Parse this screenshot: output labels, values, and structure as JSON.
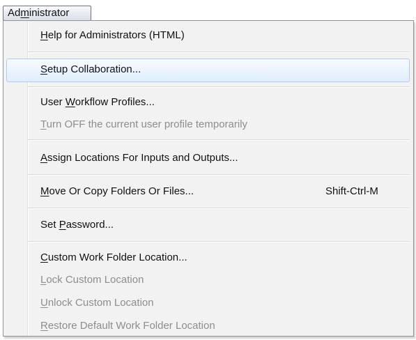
{
  "menubar": {
    "title_before_access": "Ad",
    "title_access": "m",
    "title_after_access": "inistrator"
  },
  "menu": {
    "items": [
      {
        "before": "",
        "access": "H",
        "after": "elp for Administrators (HTML)",
        "enabled": true,
        "highlighted": false
      },
      {
        "before": "",
        "access": "S",
        "after": "etup Collaboration...",
        "enabled": true,
        "highlighted": true
      },
      {
        "before": "User ",
        "access": "W",
        "after": "orkflow Profiles...",
        "enabled": true,
        "highlighted": false
      },
      {
        "before": "",
        "access": "T",
        "after": "urn OFF the current user profile temporarily",
        "enabled": false,
        "highlighted": false
      },
      {
        "before": "",
        "access": "A",
        "after": "ssign Locations For Inputs and Outputs...",
        "enabled": true,
        "highlighted": false
      },
      {
        "before": "",
        "access": "M",
        "after": "ove Or Copy Folders Or Files...",
        "shortcut": "Shift-Ctrl-M",
        "enabled": true,
        "highlighted": false
      },
      {
        "before": "Set ",
        "access": "P",
        "after": "assword...",
        "enabled": true,
        "highlighted": false
      },
      {
        "before": "",
        "access": "C",
        "after": "ustom Work Folder Location...",
        "enabled": true,
        "highlighted": false
      },
      {
        "before": "",
        "access": "L",
        "after": "ock Custom Location",
        "enabled": false,
        "highlighted": false
      },
      {
        "before": "",
        "access": "U",
        "after": "nlock Custom Location",
        "enabled": false,
        "highlighted": false
      },
      {
        "before": "",
        "access": "R",
        "after": "estore Default Work Folder Location",
        "enabled": false,
        "highlighted": false
      }
    ]
  },
  "colors": {
    "menu_background": "#f2f2f2",
    "highlight_border": "#aecdf1",
    "highlight_background": "#eaf3ff",
    "disabled_text": "#8d8d8d",
    "separator": "#d8d8d8"
  }
}
